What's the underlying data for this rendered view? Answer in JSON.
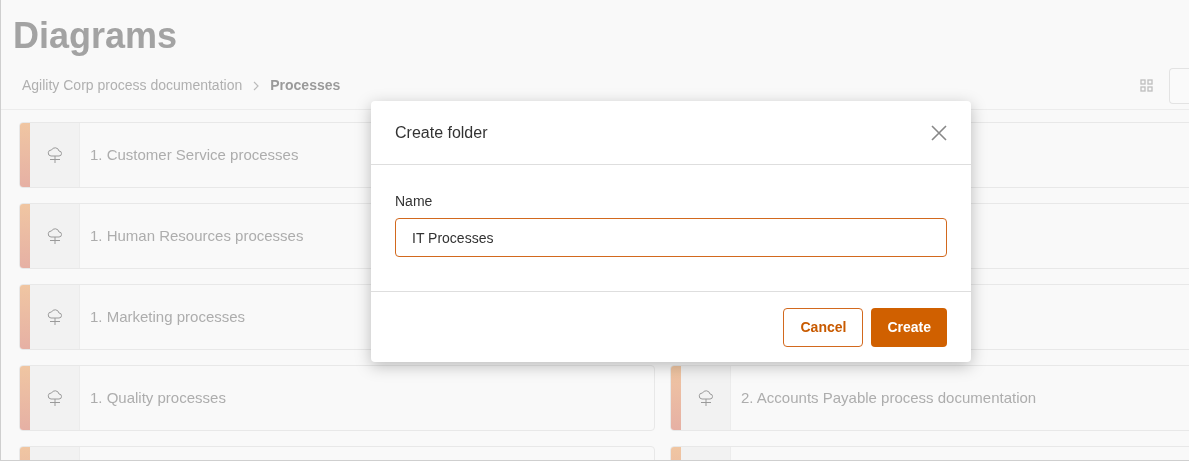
{
  "page": {
    "title": "Diagrams"
  },
  "breadcrumb": [
    {
      "label": "Agility Corp process documentation",
      "current": false
    },
    {
      "label": "Processes",
      "current": true
    }
  ],
  "folders": [
    {
      "kind": "folder",
      "label": "1. Customer Service processes"
    },
    {
      "kind": "covered"
    },
    {
      "kind": "folder",
      "label": "1. Human Resources processes"
    },
    {
      "kind": "covered"
    },
    {
      "kind": "folder",
      "label": "1. Marketing processes"
    },
    {
      "kind": "covered"
    },
    {
      "kind": "folder",
      "label": "1. Quality processes"
    },
    {
      "kind": "folder",
      "label": "2. Accounts Payable process documentation"
    },
    {
      "kind": "folder"
    },
    {
      "kind": "folder"
    }
  ],
  "dialog": {
    "title": "Create folder",
    "field_label": "Name",
    "field_value": "IT Processes",
    "buttons": [
      {
        "label": "Cancel",
        "kind": "secondary"
      },
      {
        "label": "Create",
        "kind": "primary"
      }
    ]
  }
}
